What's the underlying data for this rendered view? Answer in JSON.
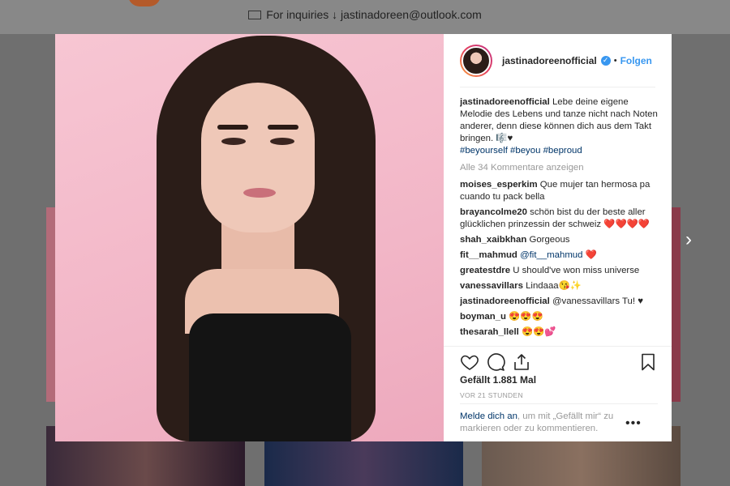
{
  "background": {
    "inquiry_text": "For inquiries ↓ jastinadoreen@outlook.com"
  },
  "post": {
    "username": "jastinadoreenofficial",
    "verified": true,
    "separator": "•",
    "follow_label": "Folgen",
    "caption_user": "jastinadoreenofficial",
    "caption_text": "Lebe deine eigene Melodie des Lebens und tanze nicht nach Noten anderer, denn diese können dich aus dem Takt bringen. 🎼♥",
    "hashtags": "#beyourself #beyou #beproud",
    "all_comments_label": "Alle 34 Kommentare anzeigen",
    "comments": [
      {
        "user": "moises_esperkim",
        "text": "Que mujer tan hermosa pa cuando tu pack bella"
      },
      {
        "user": "brayancolme20",
        "text": "schön bist du der beste aller glücklichen prinzessin der schweiz ❤️❤️❤️❤️"
      },
      {
        "user": "shah_xaibkhan",
        "text": "Gorgeous"
      },
      {
        "user": "fit__mahmud",
        "text": "@fit__mahmud ❤️"
      },
      {
        "user": "greatestdre",
        "text": "U should've won miss universe"
      },
      {
        "user": "vanessavillars",
        "text": "Lindaaa😘✨"
      },
      {
        "user": "jastinadoreenofficial",
        "text": "@vanessavillars Tu! ♥"
      },
      {
        "user": "boyman_u",
        "text": "😍😍😍"
      },
      {
        "user": "thesarah_llell",
        "text": "😍😍💕"
      }
    ],
    "likes_text": "Gefällt 1.881 Mal",
    "time_text": "VOR 21 STUNDEN",
    "login_link": "Melde dich an",
    "login_rest": ", um mit „Gefällt mir“ zu markieren oder zu kommentieren.",
    "more_label": "•••",
    "next_label": "›"
  },
  "colors": {
    "link_blue": "#3897f0",
    "hashtag_blue": "#003569",
    "like_red": "#ed4956"
  },
  "icons": [
    "mail-icon",
    "verified-icon",
    "heart-icon",
    "comment-icon",
    "share-icon",
    "bookmark-icon",
    "more-icon",
    "chevron-right-icon"
  ]
}
